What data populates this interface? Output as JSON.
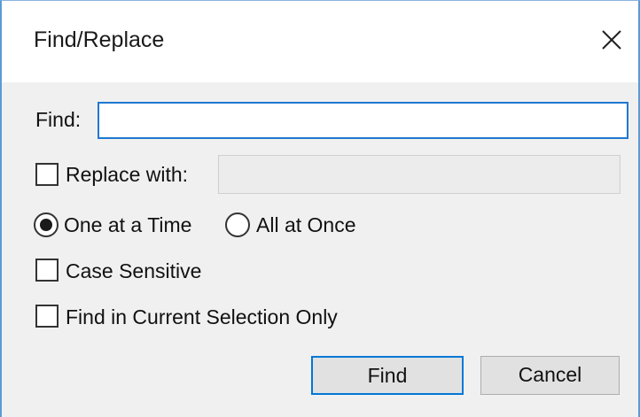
{
  "window": {
    "title": "Find/Replace"
  },
  "find": {
    "label": "Find:",
    "value": "",
    "placeholder": ""
  },
  "replace": {
    "label": "Replace with:",
    "checked": false,
    "value": "",
    "enabled": false
  },
  "mode": {
    "options": [
      {
        "label": "One at a Time",
        "selected": true
      },
      {
        "label": "All at Once",
        "selected": false
      }
    ]
  },
  "options": {
    "case_sensitive": {
      "label": "Case Sensitive",
      "checked": false
    },
    "selection_only": {
      "label": "Find in Current Selection Only",
      "checked": false
    }
  },
  "buttons": {
    "find_label": "Find",
    "cancel_label": "Cancel"
  },
  "colors": {
    "accent": "#0078d7",
    "dialog_bg": "#f0f0f0",
    "title_bg": "#ffffff",
    "border": "#5b9bd5"
  },
  "icons": {
    "close": "close-icon"
  }
}
